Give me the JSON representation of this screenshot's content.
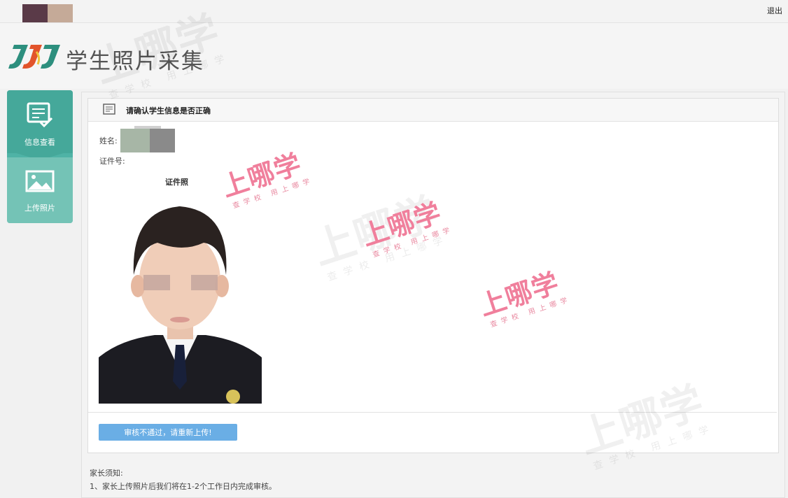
{
  "header": {
    "title": "学生照片采集",
    "logout_label": "退出",
    "brand_colors": [
      "#5a3a48",
      "#c5aa98"
    ]
  },
  "sidebar": {
    "items": [
      {
        "label": "信息查看",
        "icon": "document-check-icon",
        "active": true
      },
      {
        "label": "上传照片",
        "icon": "image-icon",
        "active": false
      }
    ]
  },
  "panel": {
    "title": "请确认学生信息是否正确",
    "name_label": "姓名:",
    "id_label": "证件号:",
    "photo_caption": "证件照",
    "action_button": "审核不通过，请重新上传!"
  },
  "notice": {
    "title": "家长须知:",
    "items": [
      "1、家长上传照片后我们将在1-2个工作日内完成审核。"
    ]
  },
  "watermark": {
    "brand": "上哪学",
    "slogan": "查学校 用上哪学"
  },
  "colors": {
    "sidebar": "#4fb3a6",
    "button": "#6aaee5",
    "watermark": "#f07f9c"
  }
}
